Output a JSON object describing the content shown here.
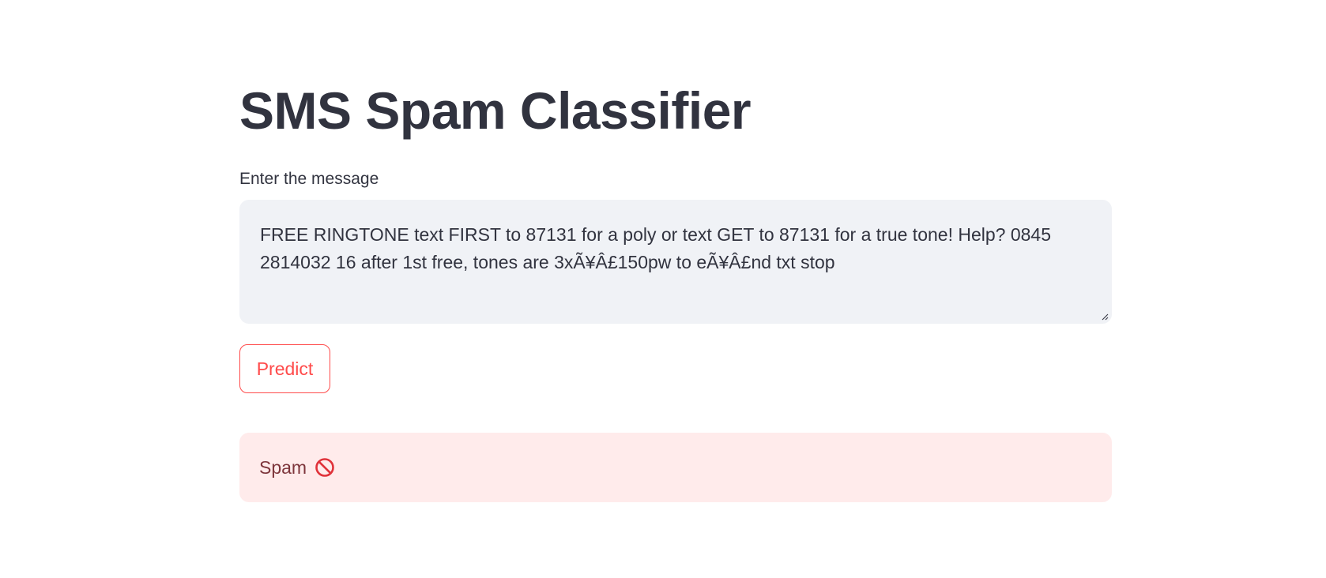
{
  "page": {
    "title": "SMS Spam Classifier"
  },
  "form": {
    "label": "Enter the message",
    "message_value": "FREE RINGTONE text FIRST to 87131 for a poly or text GET to 87131 for a true tone! Help? 0845 2814032 16 after 1st free, tones are 3xÃ¥Â£150pw to eÃ¥Â£nd txt stop",
    "predict_label": "Predict"
  },
  "result": {
    "text": "Spam",
    "icon": "prohibited-icon",
    "icon_color": "#e0323a"
  },
  "colors": {
    "accent": "#ff4b4b",
    "text": "#31333f",
    "input_bg": "#f0f2f6",
    "error_bg": "#ffebeb",
    "error_text": "#7d353b"
  }
}
